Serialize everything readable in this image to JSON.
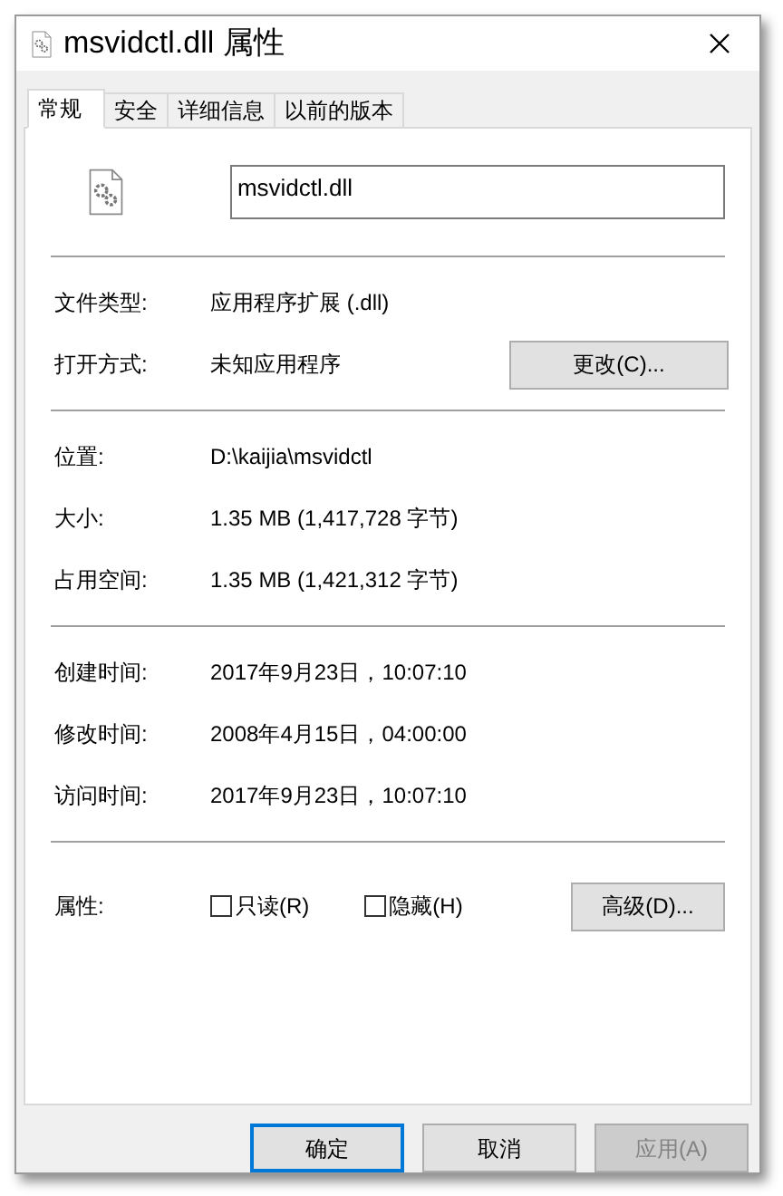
{
  "window": {
    "title": "msvidctl.dll 属性"
  },
  "tabs": [
    {
      "label": "常规",
      "selected": true
    },
    {
      "label": "安全",
      "selected": false
    },
    {
      "label": "详细信息",
      "selected": false
    },
    {
      "label": "以前的版本",
      "selected": false
    }
  ],
  "file_name": "msvidctl.dll",
  "sections": [
    {
      "rows": [
        {
          "label": "文件类型:",
          "value": "应用程序扩展 (.dll)"
        },
        {
          "label": "打开方式:",
          "value": "未知应用程序",
          "button": "更改(C)..."
        }
      ]
    },
    {
      "rows": [
        {
          "label": "位置:",
          "value": "D:\\kaijia\\msvidctl"
        },
        {
          "label": "大小:",
          "value": "1.35 MB (1,417,728 字节)"
        },
        {
          "label": "占用空间:",
          "value": "1.35 MB (1,421,312 字节)"
        }
      ]
    },
    {
      "rows": [
        {
          "label": "创建时间:",
          "value": "2017年9月23日，10:07:10"
        },
        {
          "label": "修改时间:",
          "value": "2008年4月15日，04:00:00"
        },
        {
          "label": "访问时间:",
          "value": "2017年9月23日，10:07:10"
        }
      ]
    }
  ],
  "attributes": {
    "label": "属性:",
    "checkboxes": [
      {
        "label": "只读(R)",
        "checked": false
      },
      {
        "label": "隐藏(H)",
        "checked": false
      }
    ],
    "button": "高级(D)..."
  },
  "buttons": [
    {
      "label": "确定",
      "selected": true,
      "disabled": false
    },
    {
      "label": "取消",
      "selected": false,
      "disabled": false
    },
    {
      "label": "应用(A)",
      "selected": false,
      "disabled": true
    }
  ]
}
